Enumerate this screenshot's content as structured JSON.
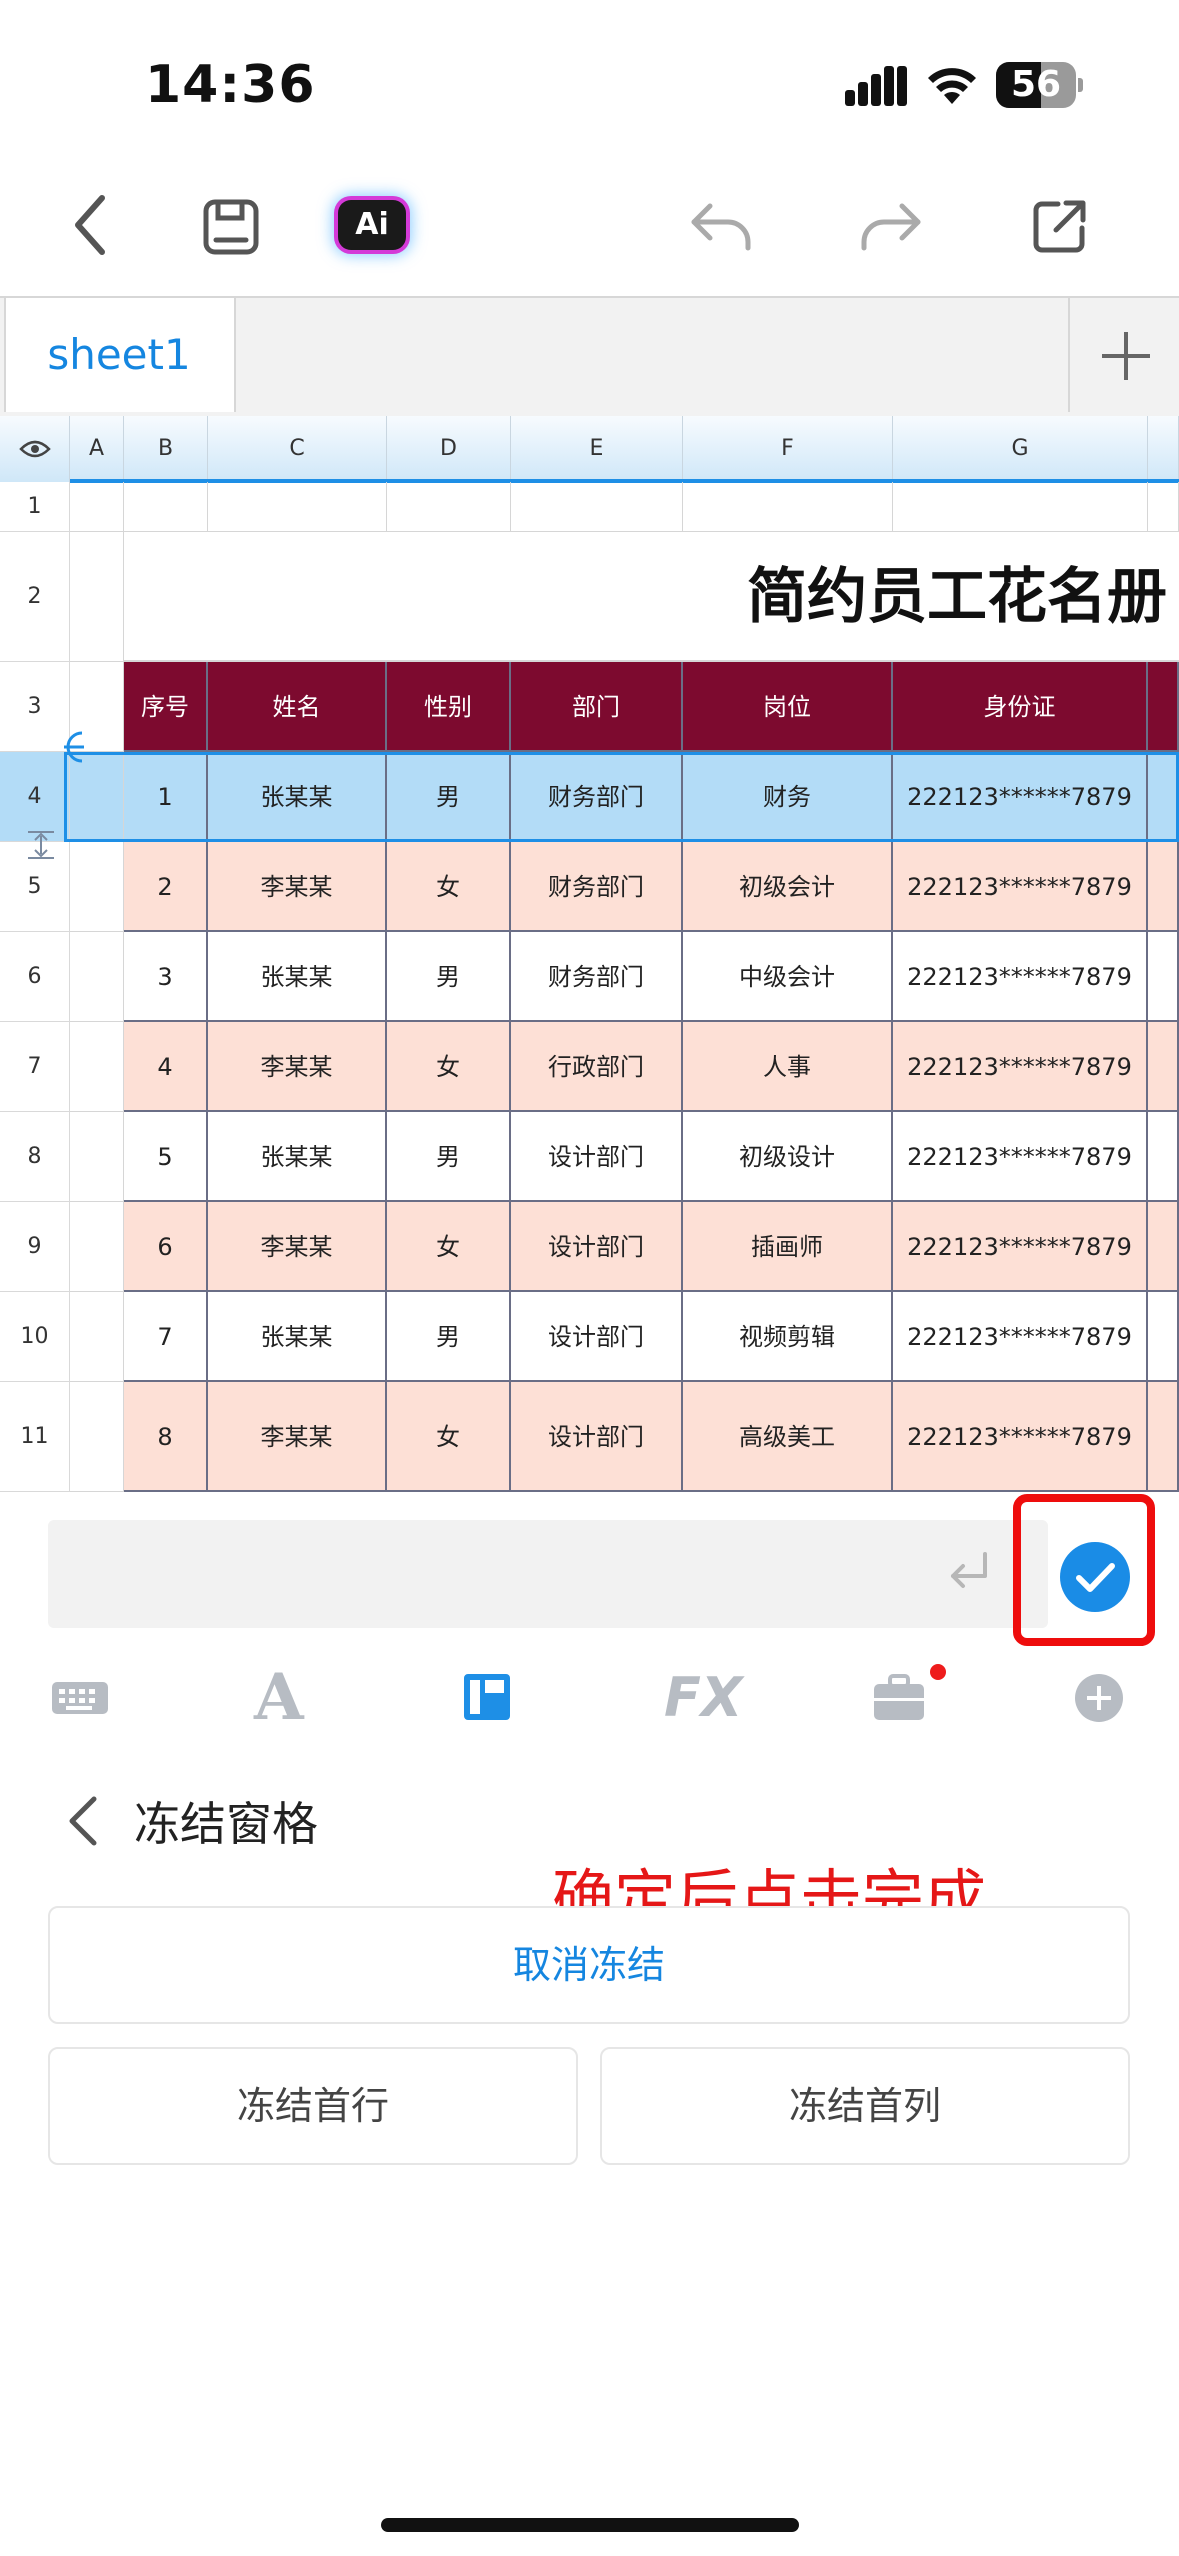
{
  "status_bar": {
    "time": "14:36",
    "battery_level": "56",
    "battery_fraction": 0.56
  },
  "toolbar": {
    "ai_label": "Ai"
  },
  "sheet_tabs": {
    "active": "sheet1"
  },
  "grid": {
    "column_headers": [
      "A",
      "B",
      "C",
      "D",
      "E",
      "F",
      "G"
    ],
    "row_numbers": [
      "1",
      "2",
      "3",
      "4",
      "5",
      "6",
      "7",
      "8",
      "9",
      "10",
      "11"
    ],
    "title": "简约员工花名册",
    "table_headers": [
      "序号",
      "姓名",
      "性别",
      "部门",
      "岗位",
      "身份证"
    ],
    "rows": [
      [
        "1",
        "张某某",
        "男",
        "财务部门",
        "财务",
        "222123******7879"
      ],
      [
        "2",
        "李某某",
        "女",
        "财务部门",
        "初级会计",
        "222123******7879"
      ],
      [
        "3",
        "张某某",
        "男",
        "财务部门",
        "中级会计",
        "222123******7879"
      ],
      [
        "4",
        "李某某",
        "女",
        "行政部门",
        "人事",
        "222123******7879"
      ],
      [
        "5",
        "张某某",
        "男",
        "设计部门",
        "初级设计",
        "222123******7879"
      ],
      [
        "6",
        "李某某",
        "女",
        "设计部门",
        "插画师",
        "222123******7879"
      ],
      [
        "7",
        "张某某",
        "男",
        "设计部门",
        "视频剪辑",
        "222123******7879"
      ],
      [
        "8",
        "李某某",
        "女",
        "设计部门",
        "高级美工",
        "222123******7879"
      ]
    ],
    "selected_row": "4"
  },
  "tool_tabs": [
    {
      "name": "keyboard-icon"
    },
    {
      "name": "font-icon",
      "label": "A"
    },
    {
      "name": "layout-icon",
      "active": true
    },
    {
      "name": "formula-icon",
      "label": "FX"
    },
    {
      "name": "toolbox-icon",
      "badge": true
    },
    {
      "name": "add-circle-icon"
    }
  ],
  "panel": {
    "title": "冻结窗格",
    "annotation": "确定后点击完成",
    "unfreeze": "取消冻结",
    "freeze_first_row": "冻结首行",
    "freeze_first_col": "冻结首列"
  },
  "colors": {
    "accent": "#1586e0",
    "header_fill": "#7d0a2f",
    "row_alt_fill": "#fde0d6",
    "selected_fill": "#b3dcf7",
    "annotation_red": "#e51717"
  }
}
